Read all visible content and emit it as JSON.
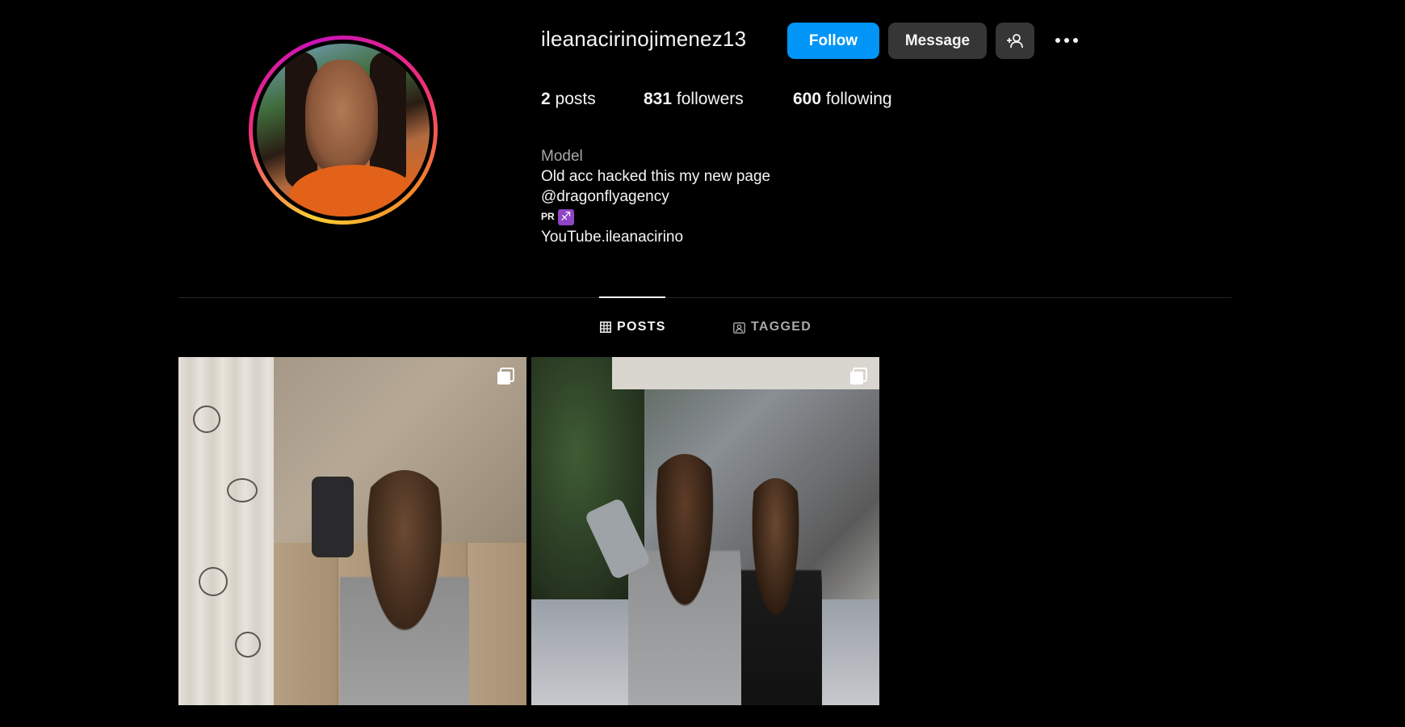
{
  "profile": {
    "username": "ileanacirinojimenez13",
    "follow_label": "Follow",
    "message_label": "Message",
    "add_user_icon": "person-add-icon",
    "more_icon": "more-options-icon"
  },
  "stats": {
    "posts_count": "2",
    "posts_label": "posts",
    "followers_count": "831",
    "followers_label": "followers",
    "following_count": "600",
    "following_label": "following"
  },
  "bio": {
    "category": "Model",
    "line1": "Old acc hacked this my new page",
    "line2": "@dragonflyagency",
    "pr_text": "PR",
    "pr_emoji": "♐",
    "link": "YouTube.ileanacirino"
  },
  "tabs": [
    {
      "label": "POSTS",
      "icon": "grid-icon",
      "active": true
    },
    {
      "label": "TAGGED",
      "icon": "tagged-icon",
      "active": false
    }
  ],
  "posts": [
    {
      "type": "carousel"
    },
    {
      "type": "carousel"
    }
  ],
  "colors": {
    "follow_button": "#0095f6",
    "secondary_button": "#363636",
    "background": "#000000",
    "muted_text": "#a8a8a8"
  }
}
